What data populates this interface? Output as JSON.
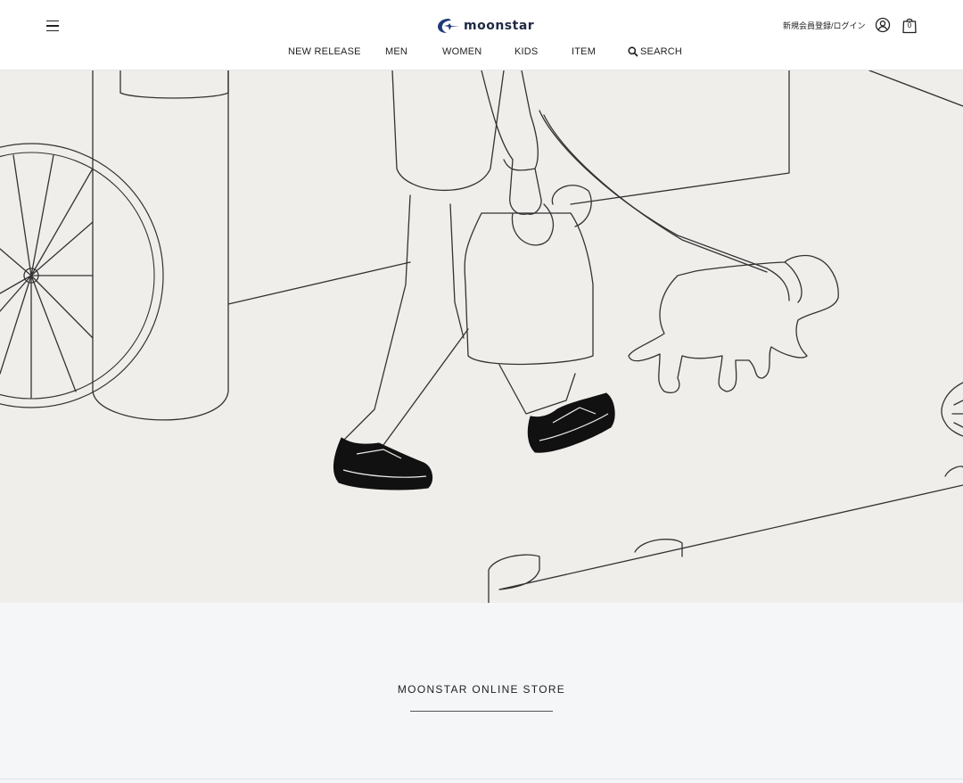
{
  "header": {
    "logo_text": "moonstar",
    "login_label": "新規会員登録/ログイン",
    "cart_count": "0",
    "icons": [
      "menu-icon",
      "moonstar-logo-mark",
      "user-icon",
      "shopping-bag-icon",
      "search-icon"
    ],
    "brand_color": "#1f3a7a"
  },
  "nav": {
    "items": [
      "NEW RELEASE",
      "MEN",
      "WOMEN",
      "KIDS",
      "ITEM"
    ],
    "search_label": "SEARCH"
  },
  "hero": {
    "description_hidden": ""
  },
  "footer": {
    "store_title": "MOONSTAR ONLINE STORE"
  }
}
